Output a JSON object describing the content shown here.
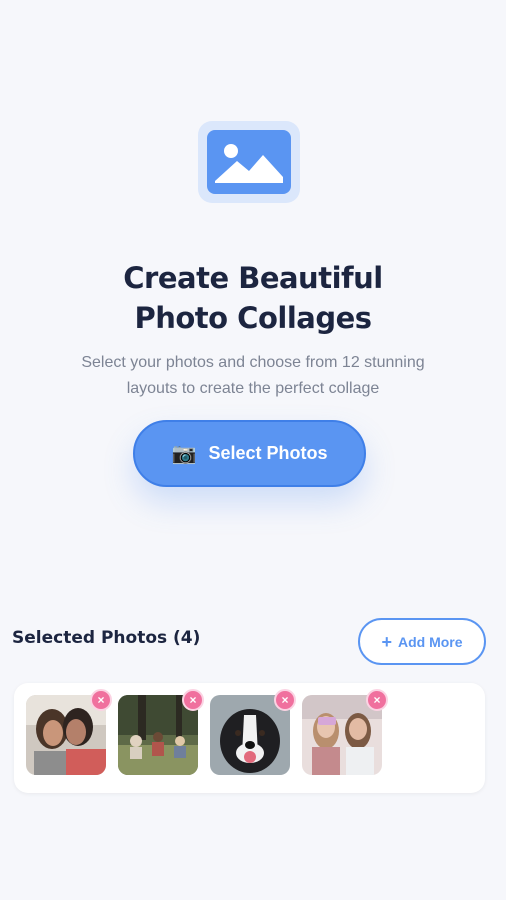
{
  "hero": {
    "icon": "image-icon",
    "title_line1": "Create Beautiful",
    "title_line2": "Photo Collages",
    "subtitle_line1": "Select your photos and choose from 12 stunning",
    "subtitle_line2": "layouts to create the perfect collage"
  },
  "select_button": {
    "icon": "camera",
    "label": "Select Photos"
  },
  "selected": {
    "title": "Selected Photos (4)",
    "add_more_label": "Add More",
    "photos": [
      {
        "description_icon": "photo-women-icon"
      },
      {
        "description_icon": "photo-picnic-icon"
      },
      {
        "description_icon": "photo-dog-icon"
      },
      {
        "description_icon": "photo-girls-icon"
      }
    ]
  },
  "colors": {
    "accent": "#5a95f2",
    "remove": "#f0709e",
    "text": "#1c2540"
  }
}
